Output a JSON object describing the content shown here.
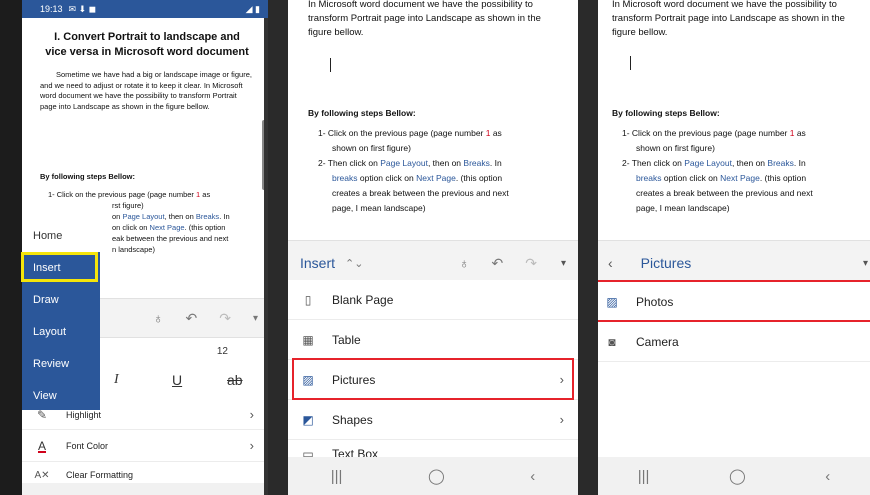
{
  "panel1": {
    "status_time": "19:13",
    "status_icons": "✉ ⬇ ◼",
    "doc_title": "I. Convert Portrait to landscape and vice versa in Microsoft word document",
    "paragraph": "Sometime we have had a big or landscape image or figure, and we need to adjust or rotate it to keep it clear. In Microsoft word document we have the possibility to transform Portrait page into Landscape as shown in the figure bellow.",
    "steps_heading": "By following steps Bellow:",
    "step1_a": "1- Click on the previous page (page number ",
    "step1_num": "1",
    "step1_b": " as",
    "step1_c": "rst figure)",
    "step2_a": "on ",
    "step2_layout": "Page Layout",
    "step2_b": ", then on ",
    "step2_breaks": "Breaks",
    "step2_c": ". In",
    "step2_d": "on click on ",
    "step2_next": "Next Page",
    "step2_e": ". (this option",
    "step2_f": "eak between the previous and next",
    "step2_g": "n landscape)",
    "tabs": [
      "Home",
      "Insert",
      "Draw",
      "Layout",
      "Review",
      "View"
    ],
    "font_size": "12",
    "format_italic": "I",
    "format_underline": "U",
    "format_strike": "ab",
    "highlight_label": "Highlight",
    "font_color_label": "Font Color",
    "clear_formatting_label": "Clear Formatting"
  },
  "panel2": {
    "top_text": "In Microsoft word document we have the possibility to transform Portrait page into Landscape as shown in the figure bellow.",
    "steps_heading": "By following steps Bellow:",
    "step1_a": "1- Click on the previous page (page number ",
    "step1_num": "1",
    "step1_b": " as",
    "step1_c": "shown on first figure)",
    "step2_a": "2- Then click on ",
    "step2_layout": "Page Layout",
    "step2_b": ", then on ",
    "step2_breaks": "Breaks",
    "step2_c": ". In",
    "step2_d1": "breaks",
    "step2_d2": " option click on ",
    "step2_next": "Next Page",
    "step2_e": ".  (this option",
    "step2_f": "creates a break between the previous and next",
    "step2_g": "page, I mean landscape)",
    "toolbar_label": "Insert",
    "items": [
      "Blank Page",
      "Table",
      "Pictures",
      "Shapes",
      "Text Box"
    ]
  },
  "panel3": {
    "top_text": "In Microsoft word document we have the possibility to transform Portrait page into Landscape as shown in the figure bellow.",
    "steps_heading": "By following steps Bellow:",
    "step1_a": "1- Click on the previous page (page number ",
    "step1_num": "1",
    "step1_b": " as",
    "step1_c": "shown on first figure)",
    "step2_a": "2- Then click on ",
    "step2_layout": "Page Layout",
    "step2_b": ", then on ",
    "step2_breaks": "Breaks",
    "step2_c": ". In",
    "step2_d1": "breaks",
    "step2_d2": " option click on ",
    "step2_next": "Next Page",
    "step2_e": ".  (this option",
    "step2_f": "creates a break between the previous and next",
    "step2_g": "page, I mean landscape)",
    "toolbar_label": "Pictures",
    "items": [
      "Photos",
      "Camera"
    ]
  },
  "nav_icons": [
    "|||",
    "◯",
    "‹"
  ],
  "colors": {
    "word_blue": "#2b579a",
    "highlight_yellow": "#f5e50a",
    "callout_red": "#e6232b"
  }
}
